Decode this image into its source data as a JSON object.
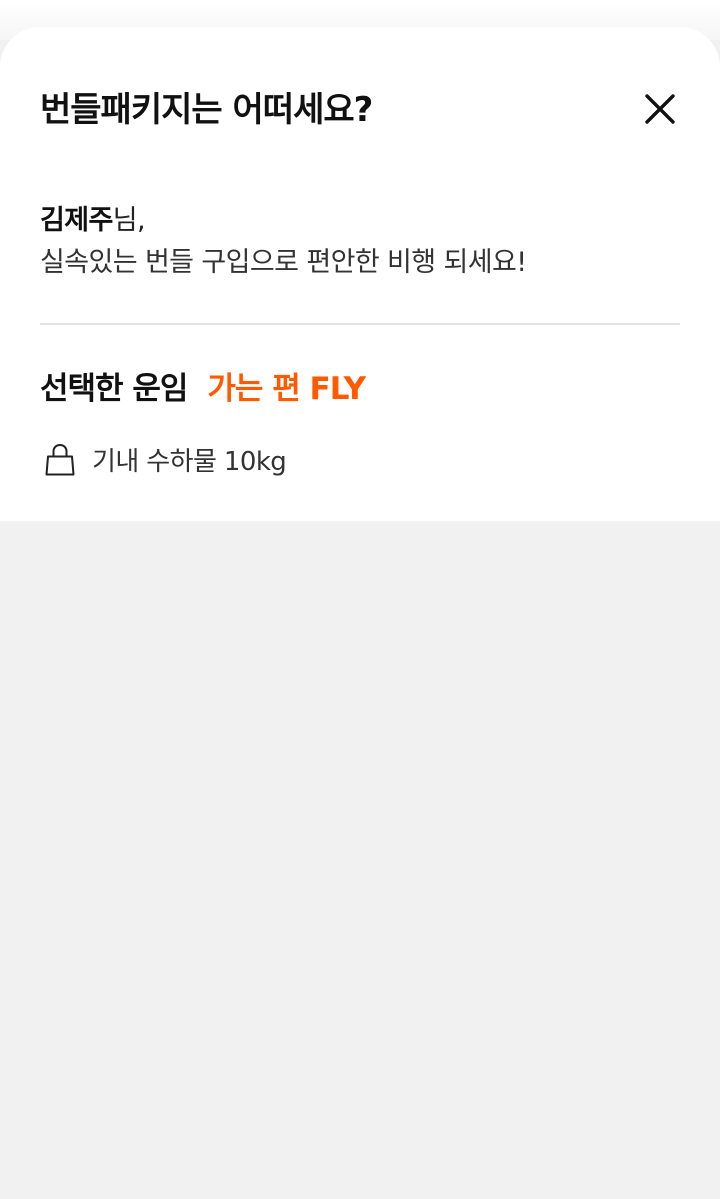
{
  "sheet": {
    "title": "번들패키지는 어떠세요?",
    "close_icon": "close-icon"
  },
  "greeting": {
    "name": "김제주",
    "suffix": "님,",
    "message": "실속있는 번들 구입으로 편안한 비행 되세요!"
  },
  "fare": {
    "label": "선택한 운임",
    "name": "가는 편 FLY"
  },
  "benefits": [
    {
      "icon": "shopping-bag-icon",
      "text": "기내 수하물 10kg"
    }
  ],
  "colors": {
    "accent": "#ff5a00",
    "background": "#f1f1f1",
    "sheet": "#ffffff",
    "divider": "#e2e2e2"
  }
}
